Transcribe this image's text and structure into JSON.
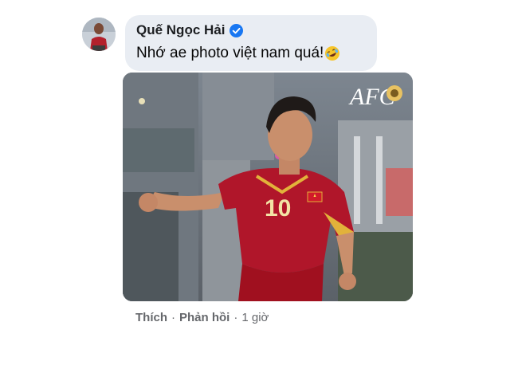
{
  "comment": {
    "author": "Quế Ngọc Hải",
    "text": "Nhớ ae photo việt nam quá!",
    "emoji": "rolling-on-floor-laughing-emoji",
    "verified_icon": "verified-badge-icon"
  },
  "photo": {
    "watermark": "AFC",
    "jersey_number": "10"
  },
  "actions": {
    "like_label": "Thích",
    "reply_label": "Phản hồi",
    "separator": "·",
    "time": "1 giờ"
  },
  "colors": {
    "bubble_bg": "#e9edf3",
    "verified_blue": "#1877f2",
    "meta_gray": "#65676b",
    "jersey_red": "#b0162a"
  }
}
